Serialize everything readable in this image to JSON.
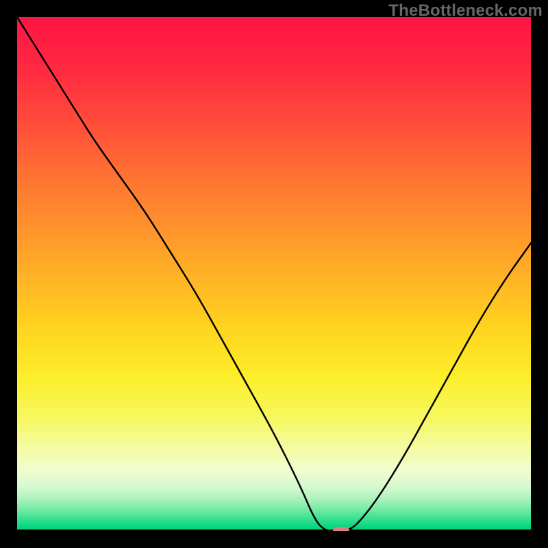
{
  "watermark": "TheBottleneck.com",
  "chart_data": {
    "type": "line",
    "title": "",
    "xlabel": "",
    "ylabel": "",
    "xlim": [
      0,
      100
    ],
    "ylim": [
      0,
      100
    ],
    "x": [
      0,
      5,
      10,
      15,
      20,
      25,
      30,
      35,
      40,
      45,
      50,
      55,
      58,
      60,
      62,
      64,
      66,
      70,
      75,
      80,
      85,
      90,
      95,
      100
    ],
    "values": [
      100,
      92,
      84,
      76,
      69,
      62,
      54,
      46,
      37,
      28,
      19,
      9,
      2,
      0,
      0,
      0,
      1,
      6,
      14,
      23,
      32,
      41,
      49,
      56
    ],
    "marker_x": 63,
    "marker_y": 0,
    "gradient_stops": [
      {
        "pct": 0.0,
        "color": "#ff1444"
      },
      {
        "pct": 0.1,
        "color": "#ff2a40"
      },
      {
        "pct": 0.2,
        "color": "#ff4a3a"
      },
      {
        "pct": 0.3,
        "color": "#ff6f33"
      },
      {
        "pct": 0.4,
        "color": "#ff902d"
      },
      {
        "pct": 0.5,
        "color": "#ffb126"
      },
      {
        "pct": 0.6,
        "color": "#ffd21e"
      },
      {
        "pct": 0.7,
        "color": "#fcee2a"
      },
      {
        "pct": 0.78,
        "color": "#f6f85e"
      },
      {
        "pct": 0.84,
        "color": "#f4fba4"
      },
      {
        "pct": 0.885,
        "color": "#f0fccf"
      },
      {
        "pct": 0.915,
        "color": "#d7f9d0"
      },
      {
        "pct": 0.94,
        "color": "#a8f2bb"
      },
      {
        "pct": 0.962,
        "color": "#6de9a3"
      },
      {
        "pct": 0.98,
        "color": "#2fdf8d"
      },
      {
        "pct": 0.993,
        "color": "#08d77f"
      },
      {
        "pct": 1.0,
        "color": "#00d47a"
      }
    ]
  }
}
